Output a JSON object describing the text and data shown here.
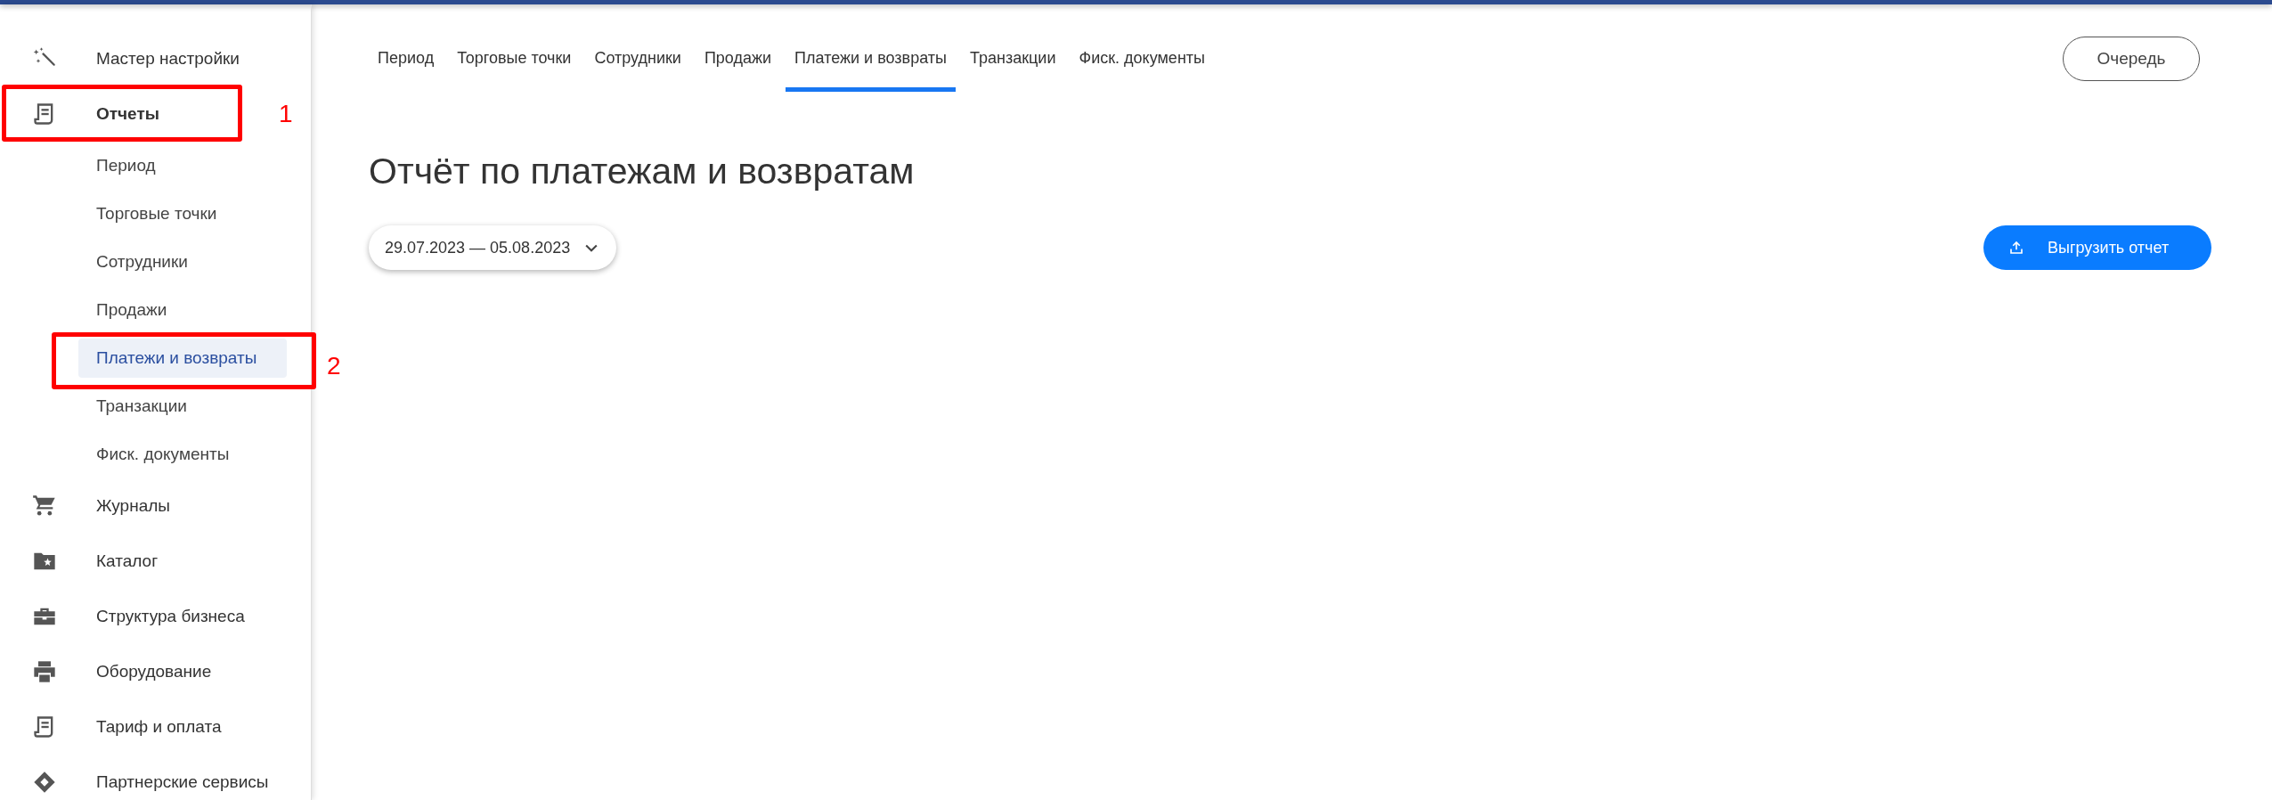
{
  "sidebar": {
    "items": [
      {
        "label": "Мастер настройки",
        "expanded": false
      },
      {
        "label": "Отчеты",
        "expanded": true,
        "children": [
          {
            "label": "Период",
            "selected": false
          },
          {
            "label": "Торговые точки",
            "selected": false
          },
          {
            "label": "Сотрудники",
            "selected": false
          },
          {
            "label": "Продажи",
            "selected": false
          },
          {
            "label": "Платежи и возвраты",
            "selected": true
          },
          {
            "label": "Транзакции",
            "selected": false
          },
          {
            "label": "Фиск. документы",
            "selected": false
          }
        ]
      },
      {
        "label": "Журналы",
        "expanded": false
      },
      {
        "label": "Каталог",
        "expanded": false
      },
      {
        "label": "Структура бизнеса",
        "expanded": false
      },
      {
        "label": "Оборудование",
        "expanded": false
      },
      {
        "label": "Тариф и оплата",
        "expanded": false
      },
      {
        "label": "Партнерские сервисы",
        "expanded": false
      }
    ]
  },
  "tabs": [
    {
      "label": "Период",
      "selected": false
    },
    {
      "label": "Торговые точки",
      "selected": false
    },
    {
      "label": "Сотрудники",
      "selected": false
    },
    {
      "label": "Продажи",
      "selected": false
    },
    {
      "label": "Платежи и возвраты",
      "selected": true
    },
    {
      "label": "Транзакции",
      "selected": false
    },
    {
      "label": "Фиск. документы",
      "selected": false
    }
  ],
  "queue_button": "Очередь",
  "title": "Отчёт по платежам и возвратам",
  "date_range": "29.07.2023 — 05.08.2023",
  "export_button": "Выгрузить отчет",
  "annotations": [
    {
      "label": "1"
    },
    {
      "label": "2"
    }
  ]
}
